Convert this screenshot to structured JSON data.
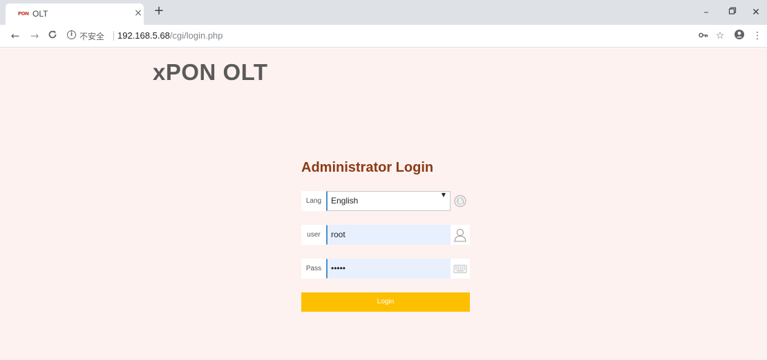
{
  "browser": {
    "tab_title": "OLT",
    "favicon_text": "PON",
    "security_label": "不安全",
    "url_host": "192.168.5.68",
    "url_path": "/cgi/login.php"
  },
  "page": {
    "brand_title": "xPON OLT",
    "login_title": "Administrator Login",
    "lang": {
      "label": "Lang",
      "value": "English"
    },
    "user": {
      "label": "user",
      "value": "root"
    },
    "pass": {
      "label": "Pass",
      "value": "•••••"
    },
    "login_button": "Login"
  },
  "colors": {
    "page_background": "#fdf2f0",
    "title": "#8b3a14",
    "button": "#fdc000",
    "input_accent": "#4a90c8"
  },
  "icons": {
    "lang_addon": "globe-icon",
    "user_addon": "person-icon",
    "pass_addon": "keyboard-icon"
  }
}
